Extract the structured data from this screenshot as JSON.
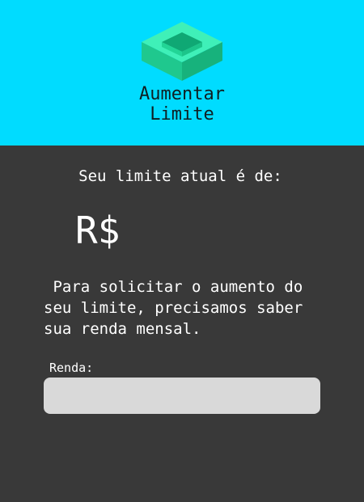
{
  "header": {
    "logo_icon": "green-hollow-cube-icon",
    "title_line1": "Aumentar",
    "title_line2": "Limite",
    "background_color": "#00dcff",
    "logo_color": "#2fe0a0"
  },
  "main": {
    "limit_label": "Seu limite atual é de:",
    "currency_symbol": "R$",
    "info_text": " Para solicitar o aumento do\nseu limite, precisamos saber\nsua renda mensal.",
    "income_label": "Renda:",
    "income_value": "",
    "income_placeholder": "",
    "background_color": "#393939",
    "input_color": "#d9d9d9"
  }
}
